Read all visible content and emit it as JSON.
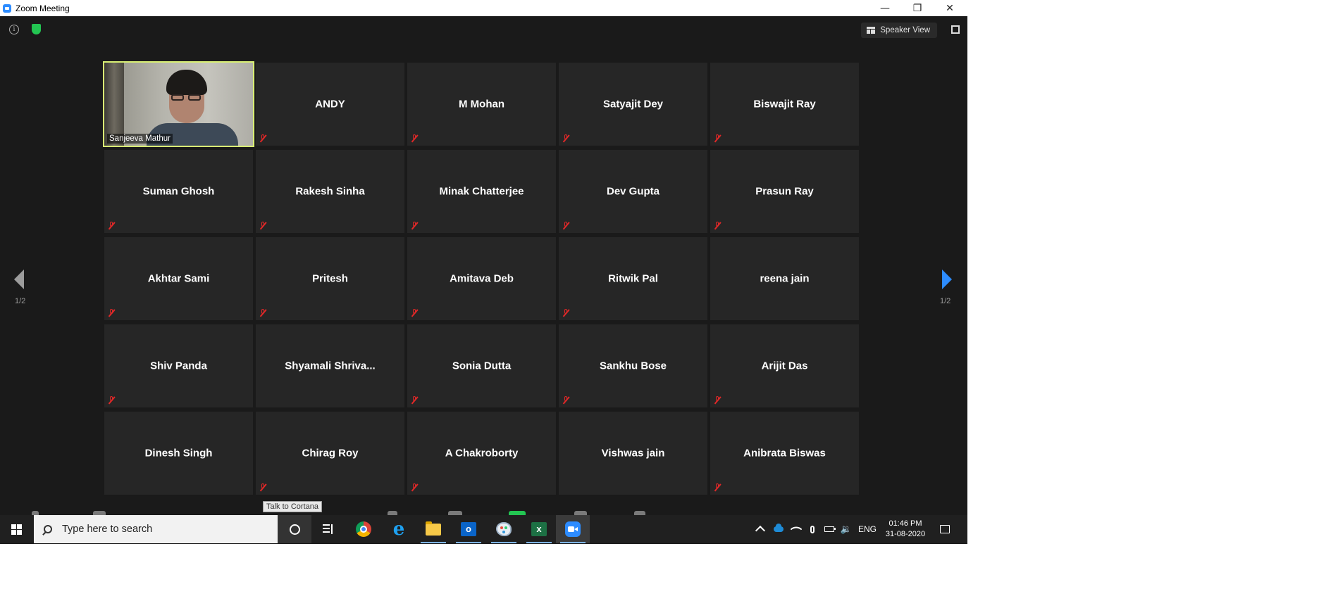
{
  "window": {
    "title": "Zoom Meeting",
    "minimize": "—",
    "restore": "❐",
    "close": "✕"
  },
  "meeting_bar": {
    "view_label": "Speaker View"
  },
  "gallery": {
    "page_indicator_left": "1/2",
    "page_indicator_right": "1/2",
    "video_participant": "Sanjeeva Mathur",
    "participants": [
      "ANDY",
      "M Mohan",
      "Satyajit Dey",
      "Biswajit Ray",
      "Suman Ghosh",
      "Rakesh Sinha",
      "Minak Chatterjee",
      "Dev Gupta",
      "Prasun Ray",
      "Akhtar Sami",
      "Pritesh",
      "Amitava Deb",
      "Ritwik Pal",
      "reena jain",
      "Shiv Panda",
      "Shyamali  Shriva...",
      "Sonia Dutta",
      "Sankhu Bose",
      "Arijit Das",
      "Dinesh Singh",
      "Chirag Roy",
      "A Chakroborty",
      "Vishwas jain",
      "Anibrata Biswas"
    ]
  },
  "tooltip": "Talk to Cortana",
  "taskbar": {
    "search_placeholder": "Type here to search",
    "language": "ENG",
    "time": "01:46 PM",
    "date": "31-08-2020"
  }
}
